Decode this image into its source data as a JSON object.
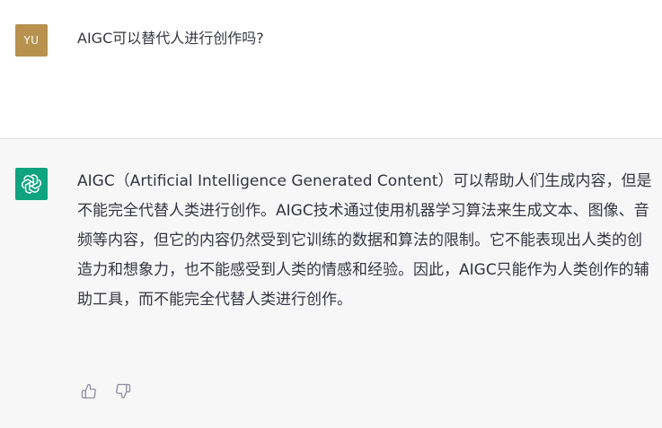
{
  "user_message": {
    "avatar_initials": "YU",
    "avatar_color": "#b8914f",
    "text": "AIGC可以替代人进行创作吗?"
  },
  "assistant_message": {
    "avatar_icon": "openai-logo-icon",
    "avatar_color": "#10a37f",
    "text": "AIGC（Artificial Intelligence Generated Content）可以帮助人们生成内容，但是不能完全代替人类进行创作。AIGC技术通过使用机器学习算法来生成文本、图像、音频等内容，但它的内容仍然受到它训练的数据和算法的限制。它不能表现出人类的创造力和想象力，也不能感受到人类的情感和经验。因此，AIGC只能作为人类创作的辅助工具，而不能完全代替人类进行创作。"
  },
  "feedback": {
    "thumbs_up_icon": "thumbs-up-icon",
    "thumbs_down_icon": "thumbs-down-icon",
    "icon_color": "#8e8ea0"
  }
}
